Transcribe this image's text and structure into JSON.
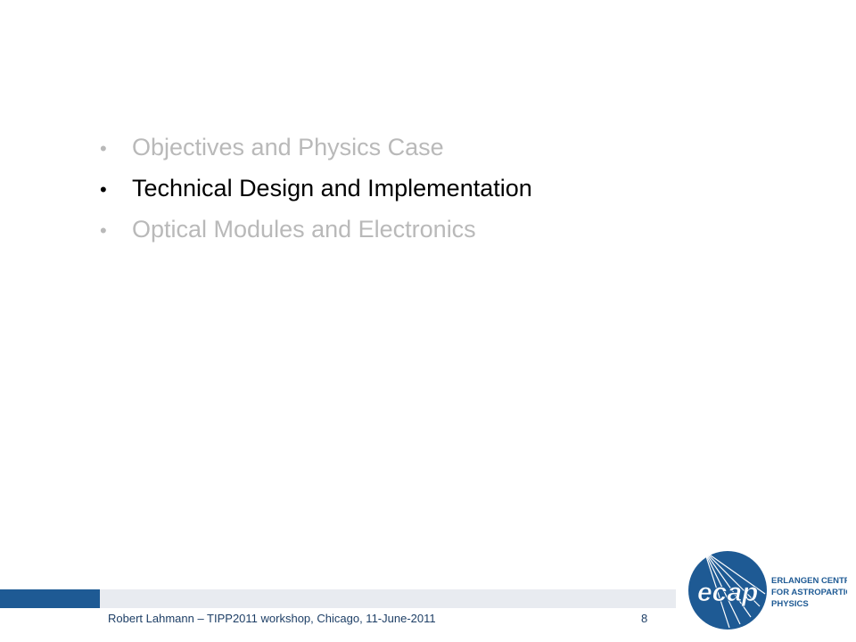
{
  "agenda": {
    "items": [
      {
        "label": "Objectives and Physics Case",
        "state": "inactive"
      },
      {
        "label": "Technical Design and Implementation",
        "state": "active"
      },
      {
        "label": "Optical Modules and Electronics",
        "state": "inactive"
      }
    ]
  },
  "footer": {
    "text": "Robert Lahmann – TIPP2011 workshop, Chicago, 11-June-2011",
    "slide_number": "8"
  },
  "logo": {
    "wordmark": "ecap",
    "line1": "ERLANGEN CENTRE",
    "line2": "FOR ASTROPARTICLE",
    "line3": "PHYSICS",
    "color": "#1e5a94"
  },
  "colors": {
    "active_text": "#000000",
    "inactive_text": "#b9b9b9",
    "brand_blue": "#1e5a94",
    "footer_bar_light": "#e8ebf0"
  }
}
